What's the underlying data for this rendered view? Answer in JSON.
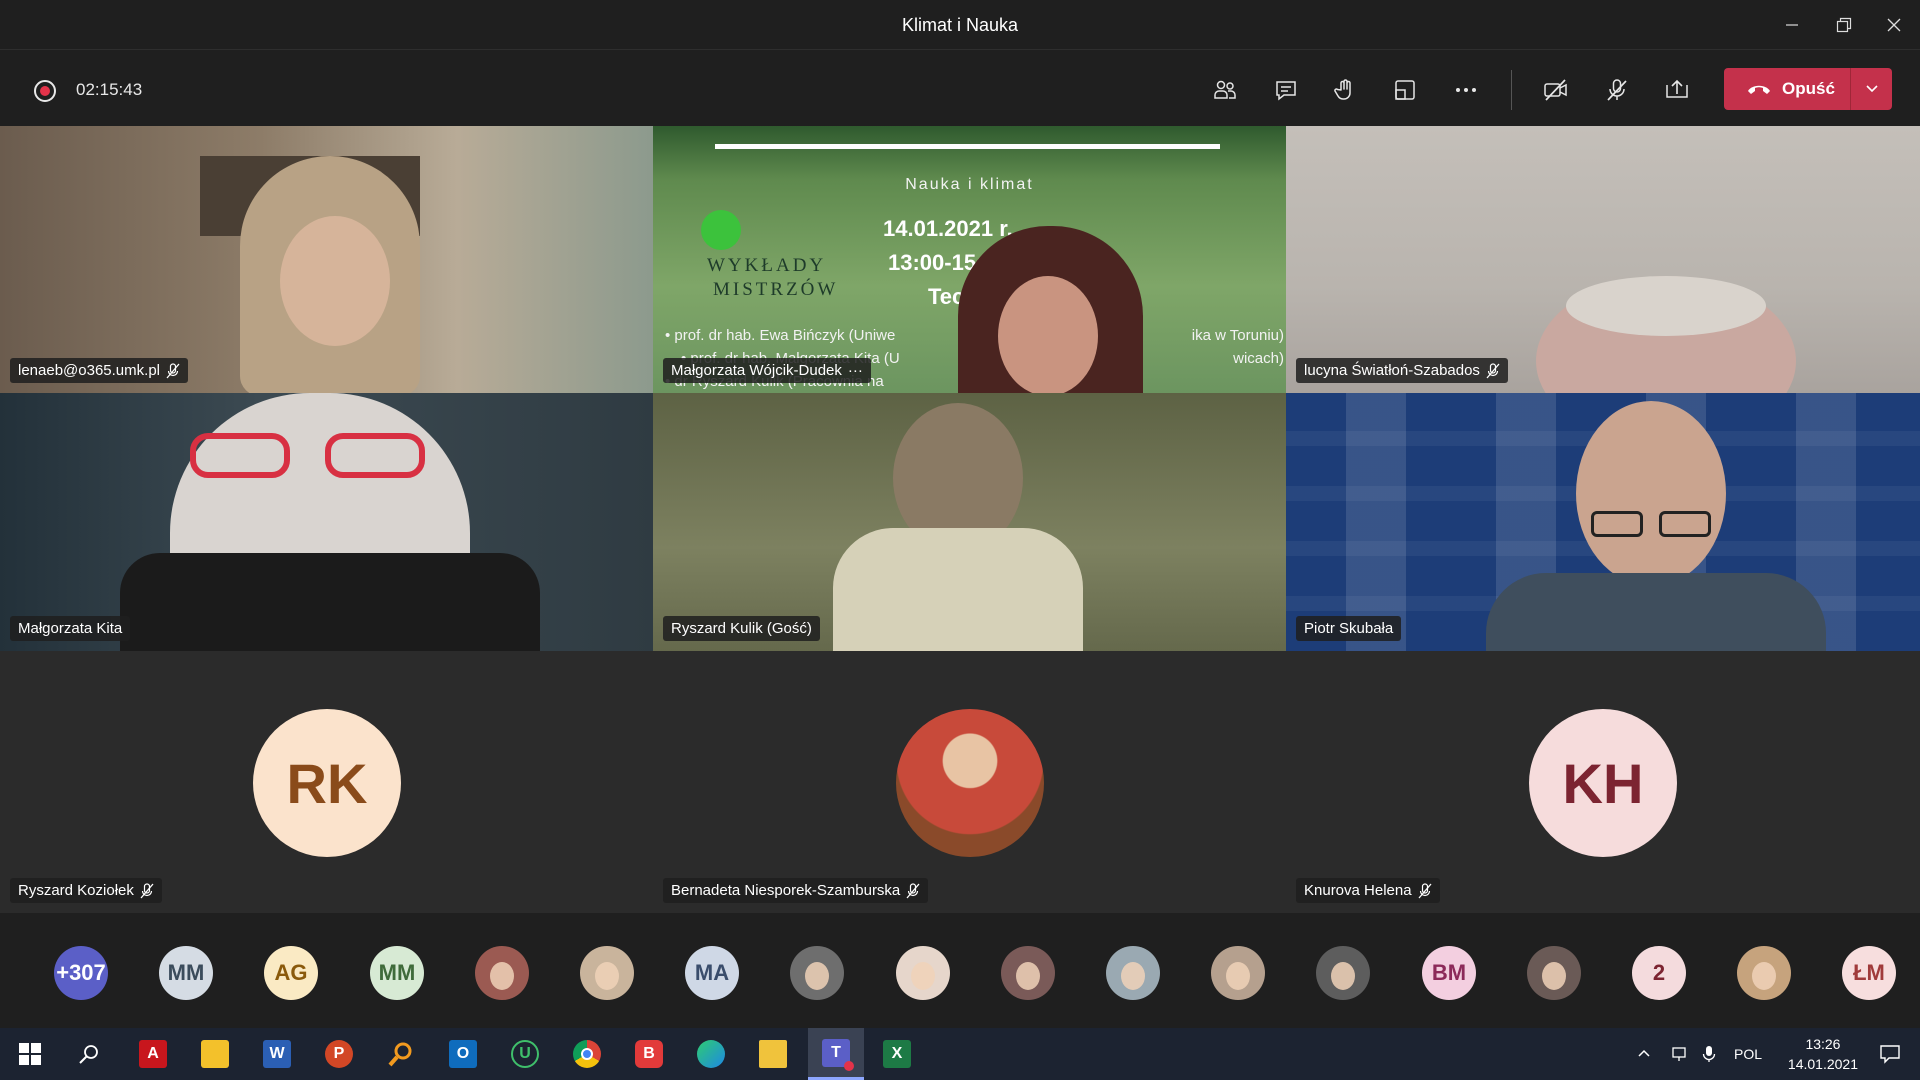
{
  "window": {
    "title": "Klimat i Nauka"
  },
  "meeting": {
    "timer": "02:15:43",
    "leave_label": "Opuść",
    "accent": "#c4314b"
  },
  "toolbar": {
    "icons": [
      "participants-icon",
      "chat-icon",
      "raise-hand-icon",
      "rooms-icon",
      "more-options-icon",
      "camera-off-icon",
      "mic-off-icon",
      "share-screen-icon"
    ]
  },
  "tiles": [
    {
      "name": "lenaeb@o365.umk.pl",
      "muted": true
    },
    {
      "name": "Małgorzata Wójcik-Dudek",
      "more": "···",
      "slide": {
        "heading": "Nauka i klimat",
        "date": "14.01.2021 r.",
        "time": "13:00-15:",
        "topic": "Tec",
        "series": [
          "WYKŁADY",
          "MISTRZÓW"
        ],
        "speakers": [
          "• prof. dr hab. Ewa Bińczyk (Uniwe",
          "ika w Toruniu)",
          "• prof. dr hab. Małgorzata Kita (U",
          "wicach)",
          "• dr Ryszard Kulik (Pracownia na"
        ]
      }
    },
    {
      "name": "lucyna Światłoń-Szabados",
      "muted": true
    },
    {
      "name": "Małgorzata Kita",
      "muted": false
    },
    {
      "name": "Ryszard Kulik (Gość)",
      "muted": false
    },
    {
      "name": "Piotr Skubała",
      "muted": false
    },
    {
      "name": "Ryszard Koziołek",
      "muted": true,
      "initials": "RK"
    },
    {
      "name": "Bernadeta Niesporek-Szamburska",
      "muted": true
    },
    {
      "name": "Knurova Helena",
      "muted": true,
      "initials": "KH"
    }
  ],
  "strip": [
    {
      "text": "+307",
      "bg": "#5b5fc7",
      "fg": "#ffffff"
    },
    {
      "text": "MM",
      "bg": "#d5dce4",
      "fg": "#3b4c5c"
    },
    {
      "text": "AG",
      "bg": "#faeac4",
      "fg": "#8a5a0c"
    },
    {
      "text": "MM",
      "bg": "#d7ead4",
      "fg": "#3f6b3a"
    },
    {
      "text": "",
      "bg": "#9b5a52",
      "fg": "#ffffff",
      "photo": true
    },
    {
      "text": "",
      "bg": "#c9b49c",
      "fg": "#ffffff",
      "photo": true
    },
    {
      "text": "MA",
      "bg": "#cfd8e6",
      "fg": "#3a4d6c"
    },
    {
      "text": "",
      "bg": "#6e6e6e",
      "fg": "#ffffff",
      "photo": true
    },
    {
      "text": "",
      "bg": "#e6d6cb",
      "fg": "#ffffff",
      "photo": true
    },
    {
      "text": "",
      "bg": "#7a5a58",
      "fg": "#ffffff",
      "photo": true
    },
    {
      "text": "",
      "bg": "#9aa9b2",
      "fg": "#ffffff",
      "photo": true
    },
    {
      "text": "",
      "bg": "#b5a08e",
      "fg": "#ffffff",
      "photo": true
    },
    {
      "text": "",
      "bg": "#5d5d5d",
      "fg": "#ffffff",
      "photo": true
    },
    {
      "text": "BM",
      "bg": "#f3cfe0",
      "fg": "#8c2a5a"
    },
    {
      "text": "",
      "bg": "#6a5a56",
      "fg": "#ffffff",
      "photo": true
    },
    {
      "text": "2",
      "bg": "#f4dbdd",
      "fg": "#7c2431"
    },
    {
      "text": "",
      "bg": "#c6a37d",
      "fg": "#ffffff",
      "photo": true
    },
    {
      "text": "ŁM",
      "bg": "#f7dede",
      "fg": "#a03b3b"
    }
  ],
  "taskbar": {
    "apps": [
      "start-icon",
      "search-icon",
      "acrobat-icon",
      "sticky-notes-icon",
      "word-icon",
      "powerpoint-icon",
      "search-tool-icon",
      "outlook-icon",
      "u-app-icon",
      "chrome-icon",
      "b-app-icon",
      "edge-icon",
      "file-explorer-icon",
      "teams-icon",
      "excel-icon"
    ],
    "language": "POL",
    "time": "13:26",
    "date": "14.01.2021"
  }
}
